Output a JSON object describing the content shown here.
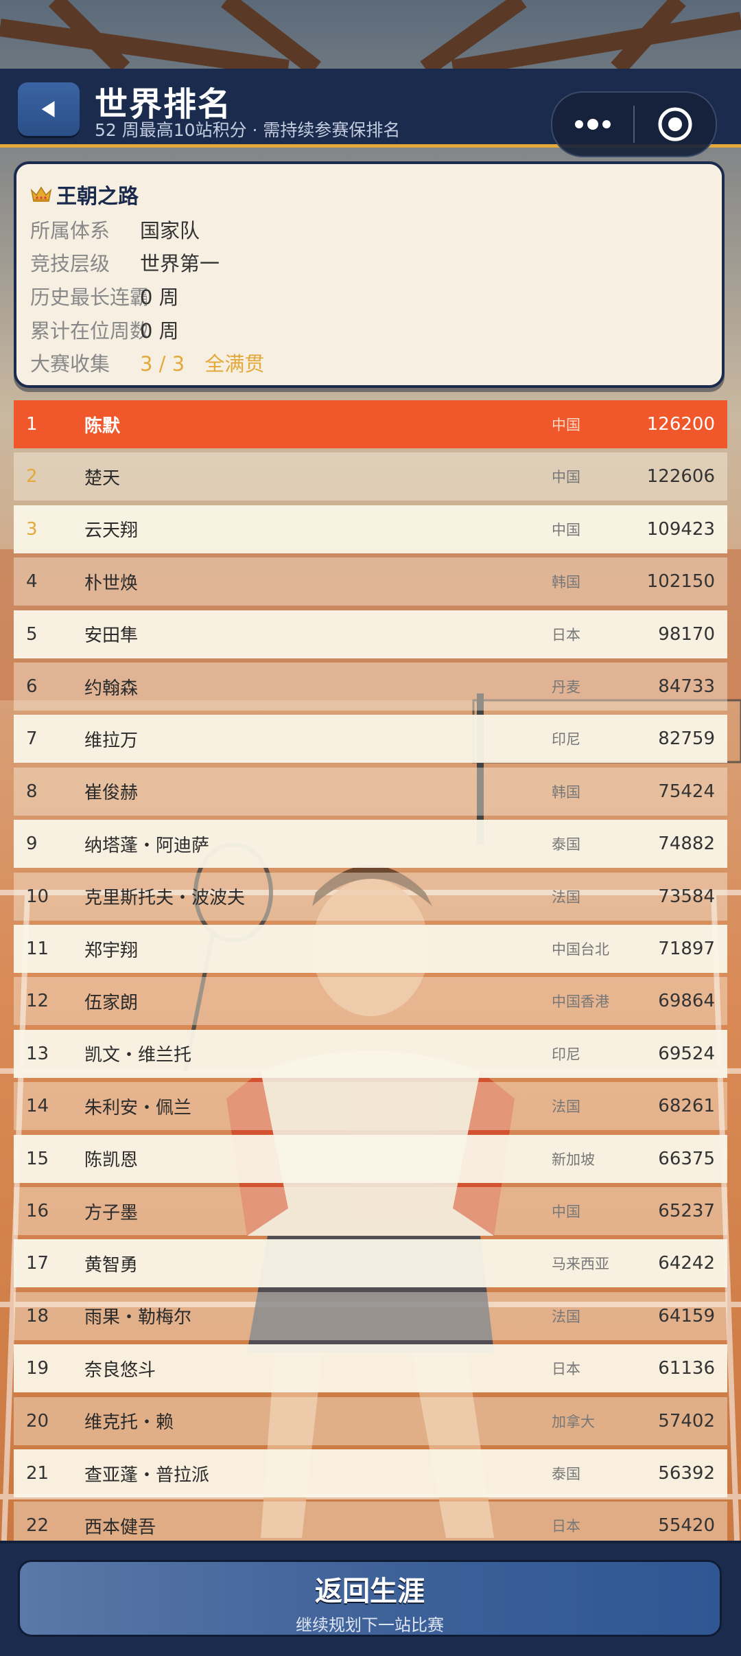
{
  "header": {
    "title": "世界排名",
    "subtitle": "52 周最高10站积分 · 需持续参赛保排名"
  },
  "card": {
    "title": "王朝之路",
    "rows": [
      {
        "label": "所属体系",
        "value": "国家队"
      },
      {
        "label": "竞技层级",
        "value": "世界第一"
      },
      {
        "label": "历史最长连霸",
        "value": "0 周"
      },
      {
        "label": "累计在位周数",
        "value": "0 周"
      },
      {
        "label": "大赛收集",
        "value": "3 / 3 ",
        "extra": "全满贯"
      }
    ]
  },
  "rankings": [
    {
      "rank": "1",
      "name": "陈默",
      "country": "中国",
      "points": "126200"
    },
    {
      "rank": "2",
      "name": "楚天",
      "country": "中国",
      "points": "122606"
    },
    {
      "rank": "3",
      "name": "云天翔",
      "country": "中国",
      "points": "109423"
    },
    {
      "rank": "4",
      "name": "朴世焕",
      "country": "韩国",
      "points": "102150"
    },
    {
      "rank": "5",
      "name": "安田隼",
      "country": "日本",
      "points": "98170"
    },
    {
      "rank": "6",
      "name": "约翰森",
      "country": "丹麦",
      "points": "84733"
    },
    {
      "rank": "7",
      "name": "维拉万",
      "country": "印尼",
      "points": "82759"
    },
    {
      "rank": "8",
      "name": "崔俊赫",
      "country": "韩国",
      "points": "75424"
    },
    {
      "rank": "9",
      "name": "纳塔蓬・阿迪萨",
      "country": "泰国",
      "points": "74882"
    },
    {
      "rank": "10",
      "name": "克里斯托夫・波波夫",
      "country": "法国",
      "points": "73584"
    },
    {
      "rank": "11",
      "name": "郑宇翔",
      "country": "中国台北",
      "points": "71897"
    },
    {
      "rank": "12",
      "name": "伍家朗",
      "country": "中国香港",
      "points": "69864"
    },
    {
      "rank": "13",
      "name": "凯文・维兰托",
      "country": "印尼",
      "points": "69524"
    },
    {
      "rank": "14",
      "name": "朱利安・佩兰",
      "country": "法国",
      "points": "68261"
    },
    {
      "rank": "15",
      "name": "陈凯恩",
      "country": "新加坡",
      "points": "66375"
    },
    {
      "rank": "16",
      "name": "方子墨",
      "country": "中国",
      "points": "65237"
    },
    {
      "rank": "17",
      "name": "黄智勇",
      "country": "马来西亚",
      "points": "64242"
    },
    {
      "rank": "18",
      "name": "雨果・勒梅尔",
      "country": "法国",
      "points": "64159"
    },
    {
      "rank": "19",
      "name": "奈良悠斗",
      "country": "日本",
      "points": "61136"
    },
    {
      "rank": "20",
      "name": "维克托・赖",
      "country": "加拿大",
      "points": "57402"
    },
    {
      "rank": "21",
      "name": "查亚蓬・普拉派",
      "country": "泰国",
      "points": "56392"
    },
    {
      "rank": "22",
      "name": "西本健吾",
      "country": "日本",
      "points": "55420"
    }
  ],
  "footer": {
    "button_label": "返回生涯",
    "button_sub": "继续规划下一站比赛"
  },
  "colors": {
    "navy": "#1b2b4d",
    "gold": "#e3a93a",
    "highlight": "#f0582b",
    "card_bg": "#f6efe2"
  },
  "icons": {
    "back": "back-arrow-icon",
    "more": "more-dots-icon",
    "close": "target-circle-icon",
    "crown": "crown-icon"
  }
}
